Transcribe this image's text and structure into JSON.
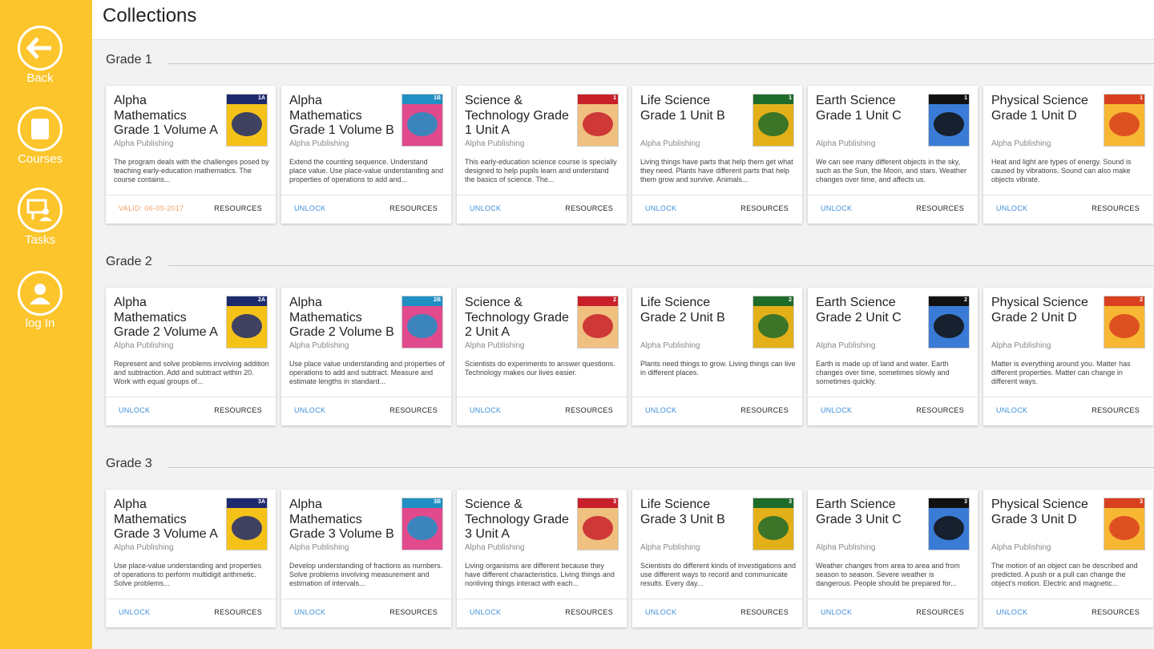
{
  "sidebar": {
    "items": [
      {
        "label": "Back",
        "icon": "back-arrow-icon"
      },
      {
        "label": "Courses",
        "icon": "courses-icon"
      },
      {
        "label": "Tasks",
        "icon": "tasks-icon"
      },
      {
        "label": "log In",
        "icon": "user-icon"
      }
    ]
  },
  "header": {
    "title": "Collections"
  },
  "colors": {
    "sidebar": "#fcc52c",
    "link": "#3e8fd8",
    "valid": "#f2a26a"
  },
  "grades": [
    {
      "label": "Grade 1",
      "courses": [
        {
          "title": "Alpha Mathematics Grade 1 Volume A",
          "publisher": "Alpha Publishing",
          "description": "The program deals with the challenges posed by teaching early-education mathematics. The course contains...",
          "action": "VALID: 06-09-2017",
          "resources": "RESOURCES",
          "cover": "1A"
        },
        {
          "title": "Alpha Mathematics Grade 1 Volume B",
          "publisher": "Alpha Publishing",
          "description": "Extend the counting sequence. Understand place value. Use place-value understanding and properties of operations to add and...",
          "action": "UNLOCK",
          "resources": "RESOURCES",
          "cover": "1B"
        },
        {
          "title": "Science & Technology Grade 1 Unit A",
          "publisher": "Alpha Publishing",
          "description": "This early-education science course is specially designed to help pupils learn and understand the basics of science. The...",
          "action": "UNLOCK",
          "resources": "RESOURCES",
          "cover": "1"
        },
        {
          "title": "Life Science Grade 1 Unit B",
          "publisher": "Alpha Publishing",
          "description": "Living things have parts that help them get what they need. Plants have different parts that help them grow and survive. Animals...",
          "action": "UNLOCK",
          "resources": "RESOURCES",
          "cover": "1"
        },
        {
          "title": "Earth Science Grade 1 Unit C",
          "publisher": "Alpha Publishing",
          "description": "We can see many different objects in the sky, such as the Sun, the Moon, and stars. Weather changes over time, and affects us.",
          "action": "UNLOCK",
          "resources": "RESOURCES",
          "cover": "1"
        },
        {
          "title": "Physical Science Grade 1 Unit D",
          "publisher": "Alpha Publishing",
          "description": "Heat and light are types of energy. Sound is caused by vibrations. Sound can also make objects vibrate.",
          "action": "UNLOCK",
          "resources": "RESOURCES",
          "cover": "1"
        }
      ]
    },
    {
      "label": "Grade 2",
      "courses": [
        {
          "title": "Alpha Mathematics Grade 2 Volume A",
          "publisher": "Alpha Publishing",
          "description": "Represent and solve problems involving addition and subtraction. Add and subtract within 20. Work with equal groups of...",
          "action": "UNLOCK",
          "resources": "RESOURCES",
          "cover": "2A"
        },
        {
          "title": "Alpha Mathematics Grade 2 Volume B",
          "publisher": "Alpha Publishing",
          "description": "Use place value understanding and properties of operations to add and subtract. Measure and estimate lengths in standard...",
          "action": "UNLOCK",
          "resources": "RESOURCES",
          "cover": "2B"
        },
        {
          "title": "Science & Technology Grade 2 Unit A",
          "publisher": "Alpha Publishing",
          "description": "Scientists do experiments to answer questions. Technology makes our lives easier.",
          "action": "UNLOCK",
          "resources": "RESOURCES",
          "cover": "2"
        },
        {
          "title": "Life Science Grade 2 Unit B",
          "publisher": "Alpha Publishing",
          "description": "Plants need things to grow. Living things can live in different places.",
          "action": "UNLOCK",
          "resources": "RESOURCES",
          "cover": "2"
        },
        {
          "title": "Earth Science Grade 2 Unit C",
          "publisher": "Alpha Publishing",
          "description": "Earth is made up of land and water. Earth changes over time, sometimes slowly and sometimes quickly.",
          "action": "UNLOCK",
          "resources": "RESOURCES",
          "cover": "2"
        },
        {
          "title": "Physical Science Grade 2 Unit D",
          "publisher": "Alpha Publishing",
          "description": "Matter is everything around you. Matter has different properties. Matter can change in different ways.",
          "action": "UNLOCK",
          "resources": "RESOURCES",
          "cover": "2"
        }
      ]
    },
    {
      "label": "Grade 3",
      "courses": [
        {
          "title": "Alpha Mathematics Grade 3 Volume A",
          "publisher": "Alpha Publishing",
          "description": "Use place-value understanding and properties of operations to perform multidigit arithmetic. Solve problems...",
          "action": "UNLOCK",
          "resources": "RESOURCES",
          "cover": "3A"
        },
        {
          "title": "Alpha Mathematics Grade 3 Volume B",
          "publisher": "Alpha Publishing",
          "description": "Develop understanding of fractions as numbers. Solve problems involving measurement and estimation of intervals...",
          "action": "UNLOCK",
          "resources": "RESOURCES",
          "cover": "3B"
        },
        {
          "title": "Science & Technology Grade 3 Unit A",
          "publisher": "Alpha Publishing",
          "description": "Living organisms are different because they have different characteristics. Living things and nonliving things interact with each...",
          "action": "UNLOCK",
          "resources": "RESOURCES",
          "cover": "3"
        },
        {
          "title": "Life Science Grade 3 Unit B",
          "publisher": "Alpha Publishing",
          "description": "Scientists do different kinds of investigations and use different ways to record and communicate results. Every day...",
          "action": "UNLOCK",
          "resources": "RESOURCES",
          "cover": "3"
        },
        {
          "title": "Earth Science Grade 3 Unit C",
          "publisher": "Alpha Publishing",
          "description": "Weather changes from area to area and from season to season. Severe weather is dangerous. People should be prepared for...",
          "action": "UNLOCK",
          "resources": "RESOURCES",
          "cover": "3"
        },
        {
          "title": "Physical Science Grade 3 Unit D",
          "publisher": "Alpha Publishing",
          "description": "The motion of an object can be described and predicted. A push or a pull can change the object's motion. Electric and magnetic...",
          "action": "UNLOCK",
          "resources": "RESOURCES",
          "cover": "3"
        }
      ]
    }
  ]
}
